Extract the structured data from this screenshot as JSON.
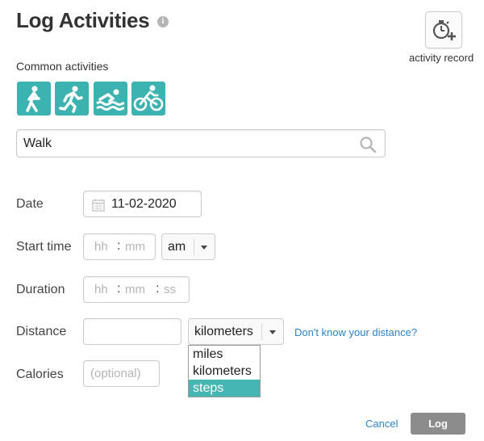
{
  "header": {
    "title": "Log Activities",
    "info_glyph": "i",
    "record_button_label": "activity record"
  },
  "common": {
    "label": "Common activities",
    "icons": [
      "walking-icon",
      "running-icon",
      "swimming-icon",
      "cycling-icon"
    ],
    "accent_color": "#3cb3b0"
  },
  "search": {
    "value": "Walk"
  },
  "form": {
    "date": {
      "label": "Date",
      "value": "11-02-2020"
    },
    "start_time": {
      "label": "Start time",
      "hh_placeholder": "hh",
      "mm_placeholder": "mm",
      "sep": ":",
      "ampm_value": "am"
    },
    "duration": {
      "label": "Duration",
      "hh_placeholder": "hh",
      "mm_placeholder": "mm",
      "ss_placeholder": "ss",
      "sep": ":"
    },
    "distance": {
      "label": "Distance",
      "value": "",
      "unit_value": "kilometers",
      "unit_options": [
        "miles",
        "kilometers",
        "steps"
      ],
      "highlighted_option": "steps",
      "help_link": "Don't know your distance?"
    },
    "calories": {
      "label": "Calories",
      "placeholder": "(optional)"
    }
  },
  "actions": {
    "cancel_label": "Cancel",
    "log_label": "Log"
  }
}
